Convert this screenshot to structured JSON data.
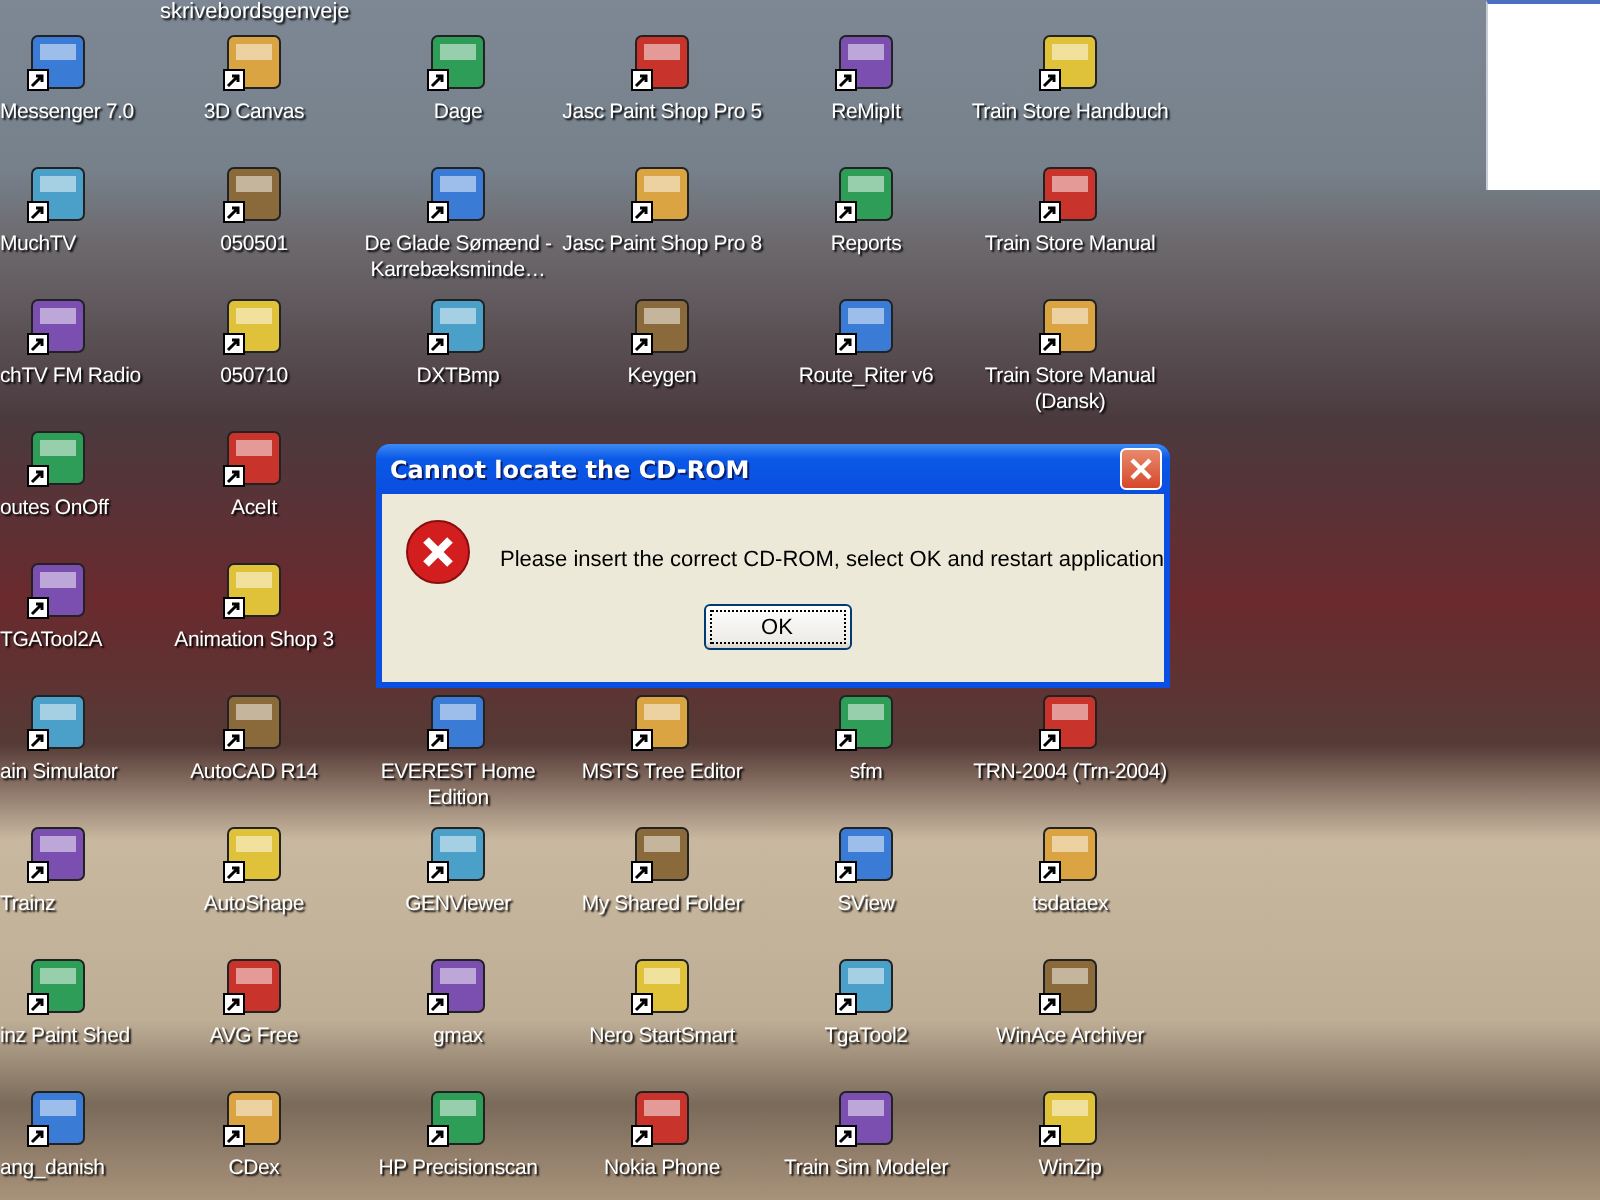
{
  "desktop_header": "skrivebordsgenveje",
  "icon_rows": [
    [
      {
        "label": "Messenger 7.0"
      },
      {
        "label": "3D Canvas"
      },
      {
        "label": "Dage"
      },
      {
        "label": "Jasc Paint Shop Pro 5"
      },
      {
        "label": "ReMipIt"
      },
      {
        "label": "Train Store Handbuch"
      }
    ],
    [
      {
        "label": "MuchTV"
      },
      {
        "label": "050501"
      },
      {
        "label": "De Glade Sømænd - Karrebæksminde…"
      },
      {
        "label": "Jasc Paint Shop Pro 8"
      },
      {
        "label": "Reports"
      },
      {
        "label": "Train Store Manual"
      }
    ],
    [
      {
        "label": "chTV FM Radio"
      },
      {
        "label": "050710"
      },
      {
        "label": "DXTBmp"
      },
      {
        "label": "Keygen"
      },
      {
        "label": "Route_Riter v6"
      },
      {
        "label": "Train Store Manual (Dansk)"
      }
    ],
    [
      {
        "label": "outes OnOff"
      },
      {
        "label": "AceIt"
      }
    ],
    [
      {
        "label": "TGATool2A"
      },
      {
        "label": "Animation Shop 3"
      }
    ],
    [
      {
        "label": "ain Simulator"
      },
      {
        "label": "AutoCAD R14"
      },
      {
        "label": "EVEREST Home Edition"
      },
      {
        "label": "MSTS Tree Editor"
      },
      {
        "label": "sfm"
      },
      {
        "label": "TRN-2004 (Trn-2004)"
      }
    ],
    [
      {
        "label": "Trainz"
      },
      {
        "label": "AutoShape"
      },
      {
        "label": "GENViewer"
      },
      {
        "label": "My Shared Folder"
      },
      {
        "label": "SView"
      },
      {
        "label": "tsdataex"
      }
    ],
    [
      {
        "label": "inz Paint Shed"
      },
      {
        "label": "AVG Free"
      },
      {
        "label": "gmax"
      },
      {
        "label": "Nero StartSmart"
      },
      {
        "label": "TgaTool2"
      },
      {
        "label": "WinAce Archiver"
      }
    ],
    [
      {
        "label": "ang_danish"
      },
      {
        "label": "CDex"
      },
      {
        "label": "HP Precisionscan"
      },
      {
        "label": "Nokia Phone"
      },
      {
        "label": "Train Sim Modeler"
      },
      {
        "label": "WinZip"
      }
    ]
  ],
  "dialog": {
    "title": "Cannot locate the CD-ROM",
    "message": "Please insert the correct CD-ROM, select OK and restart application",
    "buttons": [
      "OK"
    ]
  }
}
